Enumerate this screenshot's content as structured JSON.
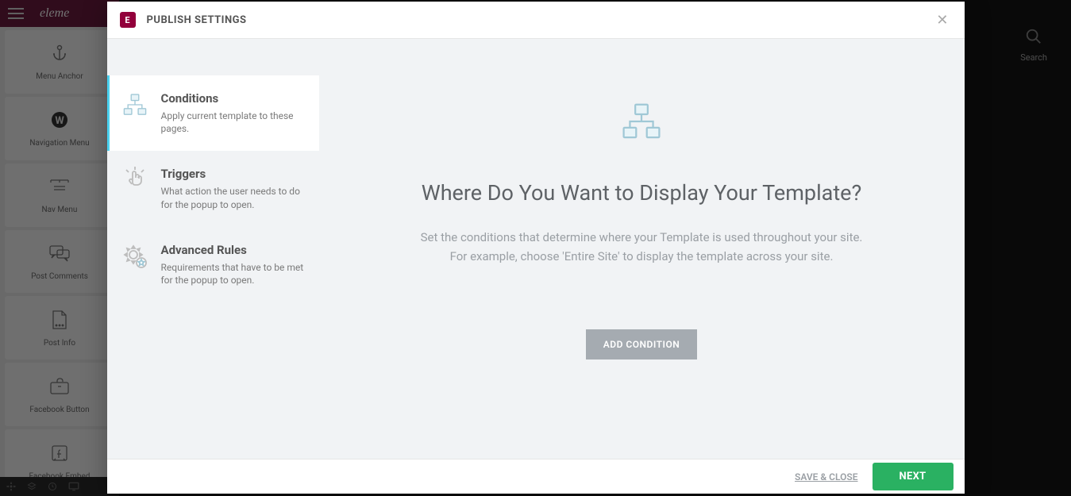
{
  "background": {
    "logo_text": "eleme",
    "widgets": [
      {
        "label": "Menu Anchor"
      },
      {
        "label": "Navigation Menu"
      },
      {
        "label": "Nav Menu"
      },
      {
        "label": "Post Comments"
      },
      {
        "label": "Post Info"
      },
      {
        "label": "Facebook Button"
      },
      {
        "label": "Facebook Embed"
      }
    ],
    "search_label": "Search"
  },
  "modal": {
    "logo_letter": "E",
    "title": "PUBLISH SETTINGS",
    "sidebar": [
      {
        "title": "Conditions",
        "desc": "Apply current template to these pages.",
        "active": true
      },
      {
        "title": "Triggers",
        "desc": "What action the user needs to do for the popup to open.",
        "active": false
      },
      {
        "title": "Advanced Rules",
        "desc": "Requirements that have to be met for the popup to open.",
        "active": false
      }
    ],
    "content": {
      "title": "Where Do You Want to Display Your Template?",
      "desc_line1": "Set the conditions that determine where your Template is used throughout your site.",
      "desc_line2": "For example, choose 'Entire Site' to display the template across your site.",
      "add_button": "ADD CONDITION"
    },
    "footer": {
      "save_close": "SAVE & CLOSE",
      "next": "NEXT"
    }
  }
}
